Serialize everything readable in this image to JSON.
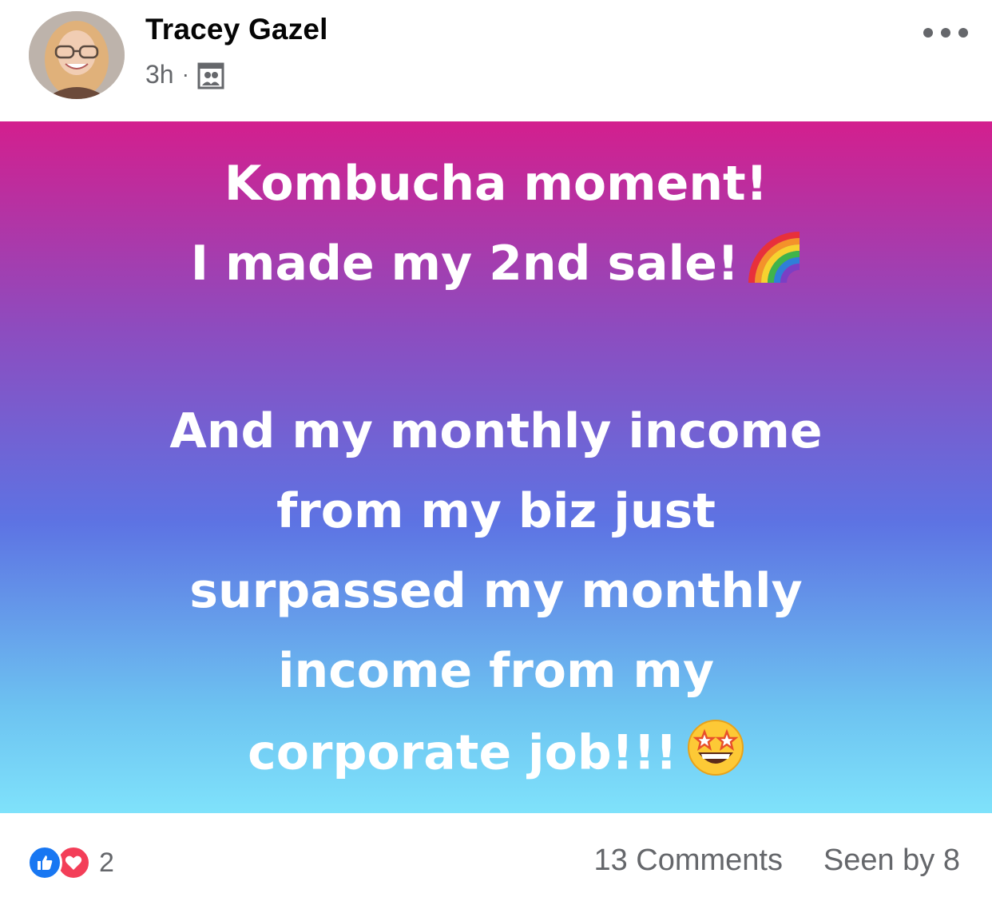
{
  "author": {
    "name": "Tracey Gazel",
    "time": "3h",
    "separator": "·",
    "audience_icon": "group-icon"
  },
  "menu": {
    "icon": "more-options-icon"
  },
  "post": {
    "lines": [
      "Kombucha moment!",
      "I made my 2nd sale!",
      "",
      "And my monthly income",
      "from my biz just",
      "surpassed my monthly",
      "income from my",
      "corporate job!!!"
    ],
    "emojis": {
      "line2": "rainbow-emoji",
      "line8": "star-struck-emoji"
    },
    "gradient": [
      "#d31f8e",
      "#8d4cbf",
      "#5d73e3",
      "#6dc3f1",
      "#7fe2fb"
    ]
  },
  "footer": {
    "reactions": [
      "like-icon",
      "love-icon"
    ],
    "reaction_count": "2",
    "comments": "13 Comments",
    "seen": "Seen by 8"
  },
  "colors": {
    "like": "#1877f2",
    "love": "#f33e58",
    "meta_text": "#65676b"
  }
}
